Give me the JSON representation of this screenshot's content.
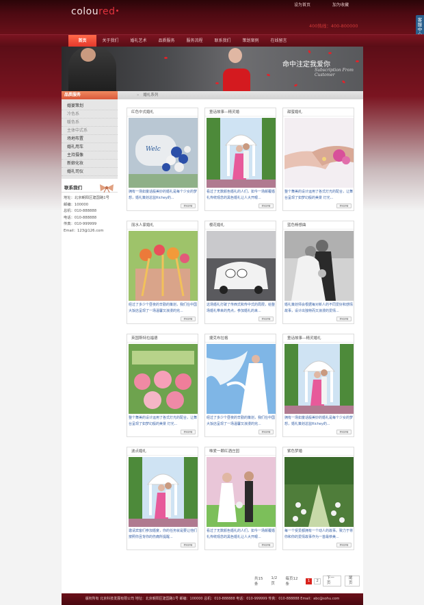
{
  "header": {
    "logo_white": "colou",
    "logo_red": "red",
    "top_links": [
      "设为首页",
      "加为收藏"
    ],
    "hotline": "400热线：400-800000",
    "side_tab": "客服中心"
  },
  "nav": {
    "items": [
      "首页",
      "关于我们",
      "婚礼艺术",
      "品质服务",
      "服务流程",
      "联系我们",
      "策划案例",
      "在线留言"
    ]
  },
  "banner": {
    "title": "命中注定我爱你",
    "subtitle": "Subscription From Customer"
  },
  "sidebar": {
    "section_title": "品质服务",
    "menu": [
      {
        "label": "婚宴策划",
        "sub": false
      },
      {
        "label": "冷色系",
        "sub": true
      },
      {
        "label": "暖色系",
        "sub": true
      },
      {
        "label": "主体中式系",
        "sub": true
      },
      {
        "label": "场地布置",
        "sub": false
      },
      {
        "label": "婚礼用车",
        "sub": false
      },
      {
        "label": "主持摄像",
        "sub": false
      },
      {
        "label": "新娘化妆",
        "sub": false
      },
      {
        "label": "婚礼司仪",
        "sub": false
      }
    ],
    "contact_title": "联系我们",
    "contact": [
      "地址：北京朝阳区建国路1号",
      "邮编：100000",
      "总机：010-888888",
      "电话：010-888888",
      "传真：010-999999",
      "Email：123@126.com"
    ]
  },
  "breadcrumb": {
    "home": "»",
    "current": "婚礼系列"
  },
  "cards": [
    {
      "title": "红色中式婚礼",
      "text": "拥有一场如童话般美妙的婚礼是每个少女的梦想，婚礼策划总监Richey的...",
      "more": "more"
    },
    {
      "title": "童话故事—精灵婚",
      "text": "看过了无数颜色婚礼的人们，如今一场颠覆婚礼传统观念的黑色婚礼让人大开眼...",
      "more": "more"
    },
    {
      "title": "甜蜜婚礼",
      "text": "整个舞美的设计运用了各式灯光的配合，让舞台呈现了如梦幻般的美景 灯光...",
      "more": "more"
    },
    {
      "title": "丽水人家婚礼",
      "text": "经过了多少个昼夜的辛勤的策划，我们在中国大饭店呈现了一场温馨又浪漫的完...",
      "more": "more"
    },
    {
      "title": "樱花婚礼",
      "text": "这场婚礼打破了传西式和传中式的局限，给整场婚礼带来的亮点，参加婚礼的来...",
      "more": "more"
    },
    {
      "title": "蓝色畅想曲",
      "text": "婚礼策划师会根据每对新人的不同爱好和感情故事，设计出独特而又浪漫的爱情...",
      "more": "more"
    },
    {
      "title": "英国斯特拉福德",
      "text": "整个舞美的设计运用了各式灯光的配合，让舞台呈现了如梦幻般的美景 灯光...",
      "more": "more"
    },
    {
      "title": "捷克布拉格",
      "text": "经过了多少个昼夜的辛勤的策划，我们在中国大饭店呈现了一场温馨又浪漫的完...",
      "more": "more"
    },
    {
      "title": "童话故事—精灵婚礼",
      "text": "拥有一场如童话般美妙的婚礼是每个少女的梦想，婚礼策划总监Richey的...",
      "more": "more"
    },
    {
      "title": "波点婚礼",
      "text": "邀请宾客们参加婚宴，你的任务就是要让他们按照你且背你的伤痛所提醒...",
      "more": "more"
    },
    {
      "title": "唯爱一颗红酒庄园",
      "text": "看过了无数颜色婚礼的人们，如今一场颠覆婚礼传统观念的黑色婚礼让人大开眼...",
      "more": "more"
    },
    {
      "title": "紫色梦婚",
      "text": "每一个受爱都拥有一个动人的故事。致力于将你和你的爱情故事作为一首最恭美...",
      "more": "more"
    }
  ],
  "pager": {
    "total": "共15条",
    "pages": "1/2页",
    "per_page": "每页12条",
    "page_numbers": [
      "1",
      "2"
    ],
    "next": "下一页",
    "last": "尾页"
  },
  "footer": {
    "text": "版权所有  北京科技发展有限公司  地址：北京朝阳区建国路1号  邮编：100000  总机：010-888888  电话：010-999999  传真：010-888888  Email：abc@sohu.com"
  },
  "colors": {
    "brand_red": "#d9231d",
    "maroon": "#6a1019",
    "link_blue": "#3a63a8"
  }
}
